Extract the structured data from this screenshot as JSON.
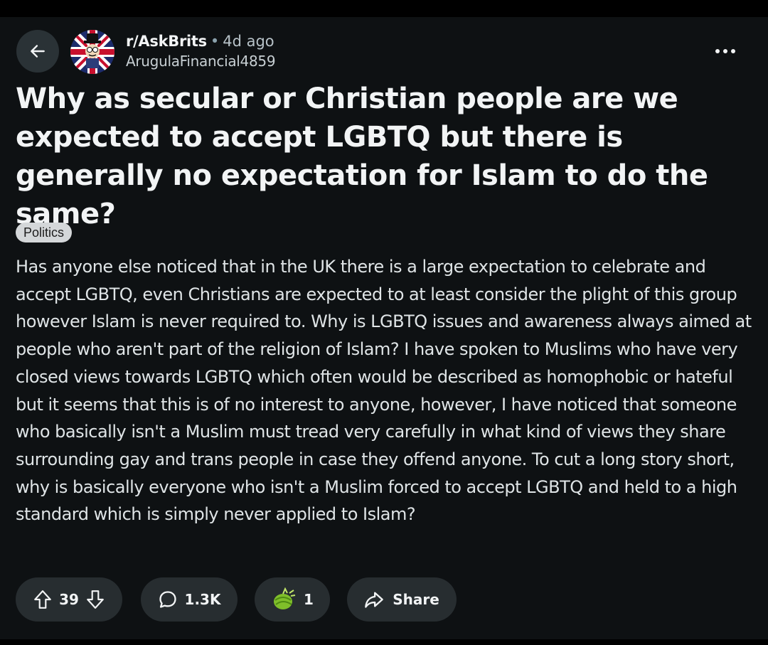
{
  "post": {
    "subreddit": "r/AskBrits",
    "separator": "•",
    "age": "4d ago",
    "author": "ArugulaFinancial4859",
    "title": "Why as secular or Christian people are we expected to accept LGBTQ but there is generally no expectation for Islam to do the same?",
    "flair": "Politics",
    "body": "Has anyone else noticed that in the UK there is a large expectation to celebrate and accept LGBTQ, even Christians are expected to at least consider the plight of this group however Islam is never required to. Why is LGBTQ issues and awareness always aimed at people who aren't part of the religion of Islam? I have spoken to Muslims who have very closed views towards LGBTQ which often would be described as homophobic or hateful but it seems that this is of no interest to anyone, however, I have noticed that someone who basically isn't a Muslim must tread very carefully in what kind of views they share surrounding gay and trans people in case they offend anyone. To cut a long story short, why is basically everyone who isn't a Muslim forced to accept LGBTQ and held to a high standard which is simply never applied to Islam?"
  },
  "actions": {
    "score": "39",
    "comments": "1.3K",
    "awards": "1",
    "share_label": "Share"
  },
  "icons": {
    "back": "arrow-left-icon",
    "more": "more-horizontal-icon",
    "upvote": "arrow-up-icon",
    "downvote": "arrow-down-icon",
    "comment": "speech-bubble-icon",
    "award": "award-icon",
    "share": "share-arrow-icon"
  },
  "colors": {
    "background": "#0e1113",
    "pill": "#272d30",
    "flair_bg": "#d4d7d9"
  }
}
